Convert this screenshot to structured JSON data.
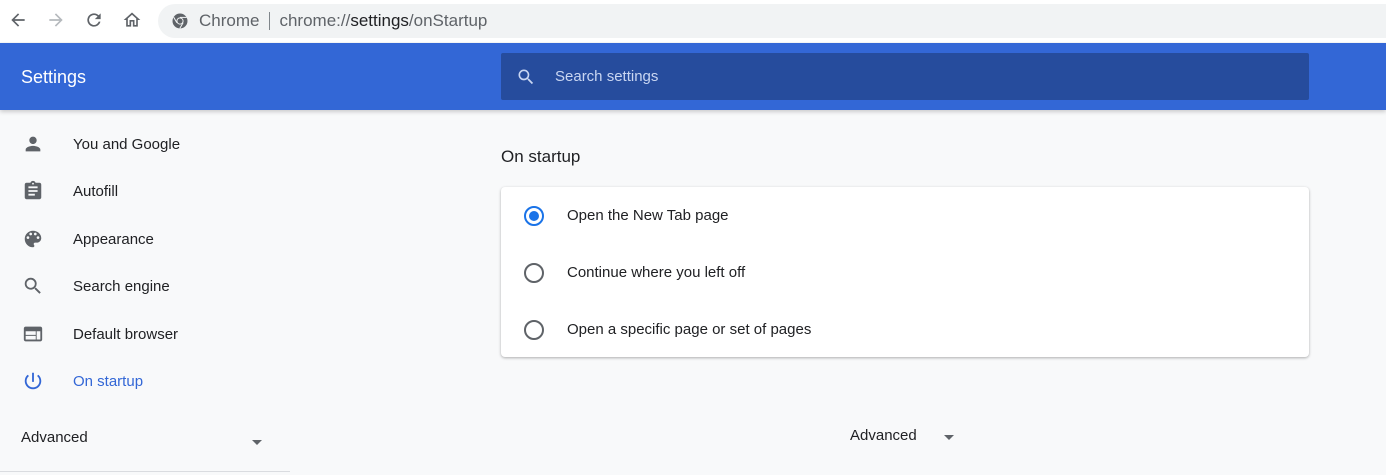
{
  "browser": {
    "nav_icons": [
      "back-arrow-icon",
      "forward-arrow-icon",
      "reload-icon",
      "home-icon"
    ],
    "omnibox": {
      "site_label": "Chrome",
      "url_scheme": "chrome://",
      "url_host": "settings",
      "url_path": "/onStartup"
    }
  },
  "header": {
    "title": "Settings",
    "search_placeholder": "Search settings",
    "background_color": "#3367d6"
  },
  "sidebar": {
    "items": [
      {
        "label": "You and Google",
        "icon": "person-icon"
      },
      {
        "label": "Autofill",
        "icon": "clipboard-icon"
      },
      {
        "label": "Appearance",
        "icon": "palette-icon"
      },
      {
        "label": "Search engine",
        "icon": "search-icon"
      },
      {
        "label": "Default browser",
        "icon": "browser-window-icon"
      },
      {
        "label": "On startup",
        "icon": "power-icon",
        "active": true
      }
    ],
    "advanced_label": "Advanced",
    "active_color": "#3367d6"
  },
  "main": {
    "section_title": "On startup",
    "options": [
      {
        "label": "Open the New Tab page",
        "selected": true
      },
      {
        "label": "Continue where you left off",
        "selected": false
      },
      {
        "label": "Open a specific page or set of pages",
        "selected": false
      }
    ],
    "advanced_label": "Advanced"
  }
}
